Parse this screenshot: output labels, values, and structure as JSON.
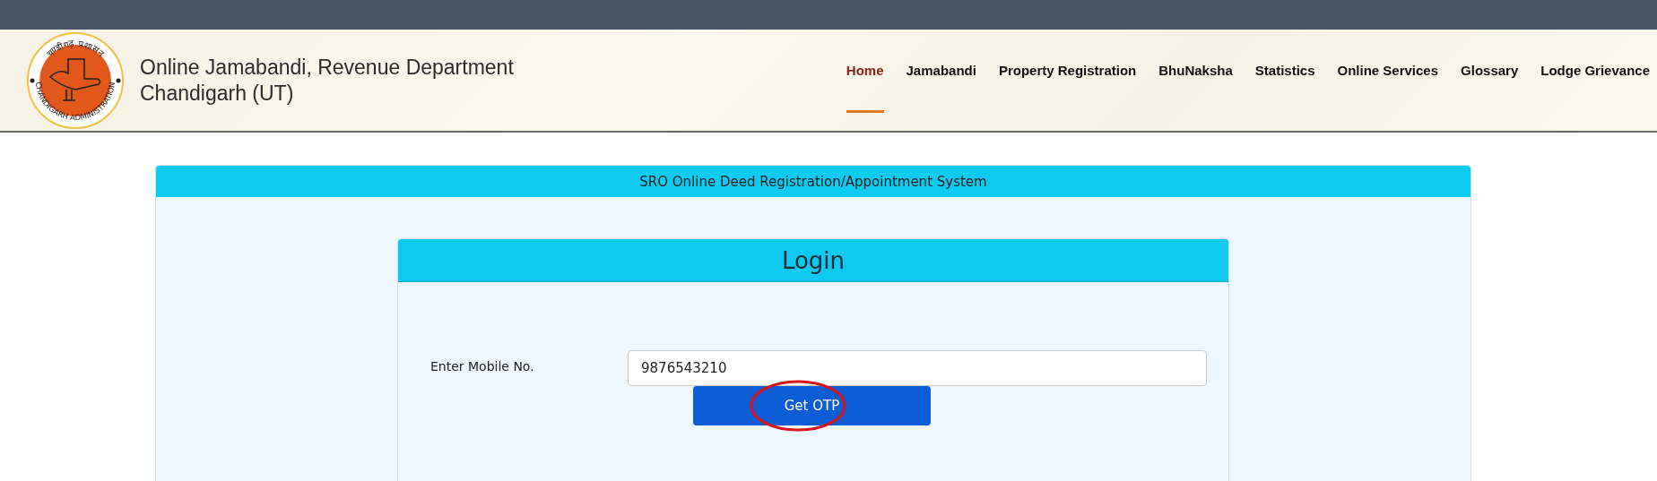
{
  "header": {
    "logo": {
      "top_text": "चण्डीगढ़ प्रशासन",
      "bottom_text": "CHANDIGARH ADMINISTRATION"
    },
    "title_lines": [
      "Online Jamabandi, Revenue Department",
      "Chandigarh (UT)"
    ],
    "nav": [
      {
        "label": "Home",
        "selected": true
      },
      {
        "label": "Jamabandi",
        "selected": false
      },
      {
        "label": "Property Registration",
        "selected": false
      },
      {
        "label": "BhuNaksha",
        "selected": false
      },
      {
        "label": "Statistics",
        "selected": false
      },
      {
        "label": "Online Services",
        "selected": false
      },
      {
        "label": "Glossary",
        "selected": false
      },
      {
        "label": "Lodge Grievance",
        "selected": false
      }
    ]
  },
  "panel": {
    "title": "SRO Online Deed Registration/Appointment System",
    "login": {
      "title": "Login",
      "mobile_label": "Enter Mobile No.",
      "mobile_value": "9876543210",
      "button": "Get OTP",
      "button_circled": true
    }
  }
}
